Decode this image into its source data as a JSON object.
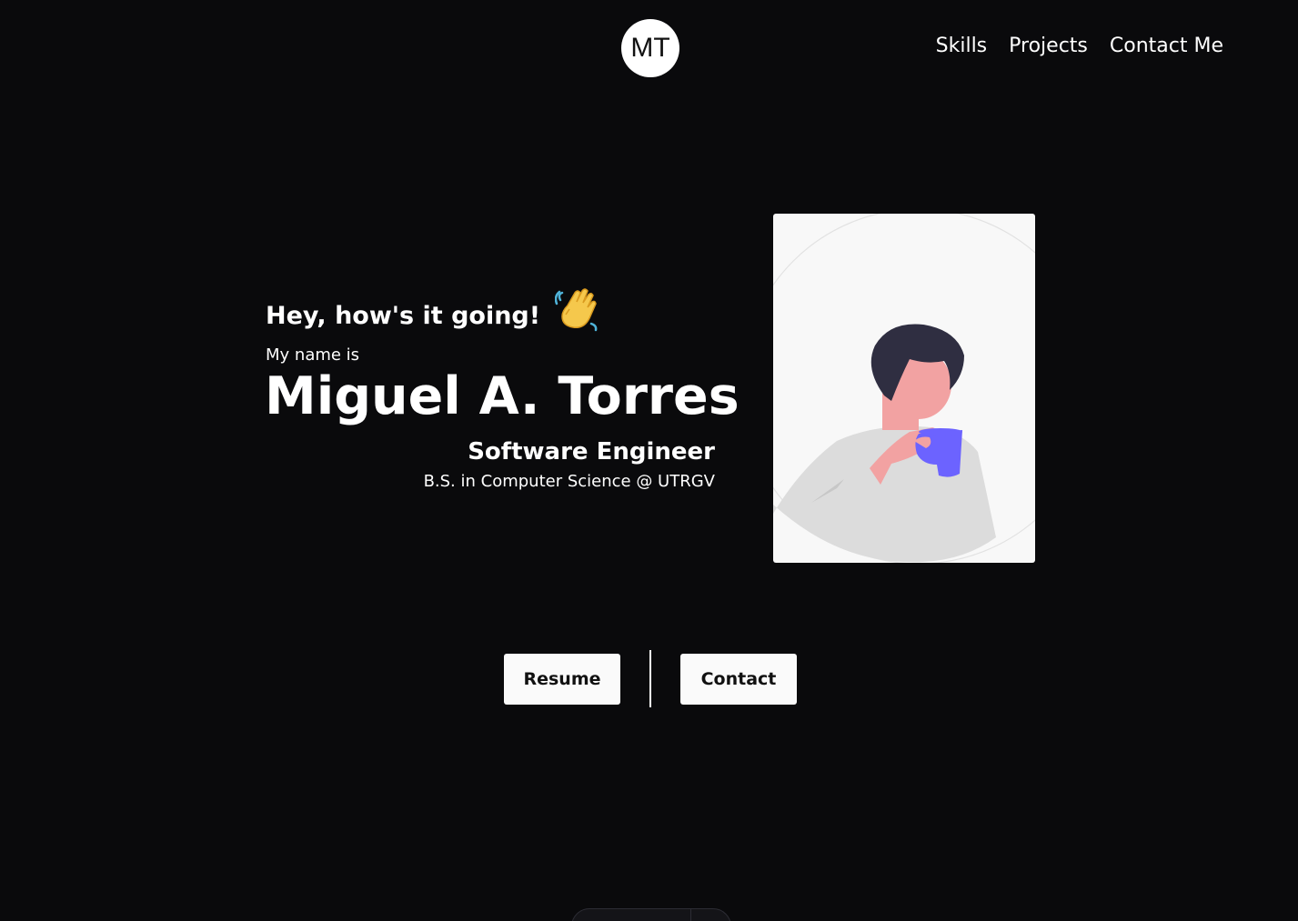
{
  "header": {
    "logo_text": "MT",
    "nav": [
      "Skills",
      "Projects",
      "Contact Me"
    ]
  },
  "hero": {
    "greeting": "Hey, how's it going!",
    "greeting_icon": "waving-hand-icon",
    "intro": "My name is",
    "name": "Miguel A. Torres",
    "role": "Software Engineer",
    "degree": "B.S. in Computer Science @ UTRGV",
    "illustration_icon": "person-with-coffee-illustration"
  },
  "actions": {
    "resume_label": "Resume",
    "contact_label": "Contact"
  },
  "colors": {
    "background": "#0a0a0c",
    "text": "#ffffff",
    "button_bg": "#fafafa",
    "cup_accent": "#6c63ff"
  }
}
